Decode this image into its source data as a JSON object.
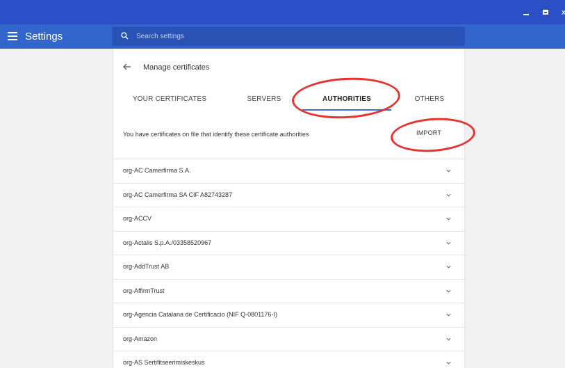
{
  "app": {
    "title": "Settings"
  },
  "window_controls": {
    "minimize_icon": "minimize-icon",
    "maximize_icon": "maximize-icon",
    "close_icon": "close-icon",
    "close_glyph": "x"
  },
  "search": {
    "placeholder": "Search settings",
    "value": ""
  },
  "page": {
    "title": "Manage certificates",
    "description": "You have certificates on file that identify these certificate authorities",
    "import_label": "IMPORT"
  },
  "tabs": [
    {
      "label": "YOUR CERTIFICATES",
      "active": false
    },
    {
      "label": "SERVERS",
      "active": false
    },
    {
      "label": "AUTHORITIES",
      "active": true
    },
    {
      "label": "OTHERS",
      "active": false
    }
  ],
  "authorities": [
    "org-AC Camerfirma S.A.",
    "org-AC Camerfirma SA CIF A82743287",
    "org-ACCV",
    "org-Actalis S.p.A./03358520967",
    "org-AddTrust AB",
    "org-AffirmTrust",
    "org-Agencia Catalana de Certificacio (NIF Q-0801176-I)",
    "org-Amazon",
    "org-AS Sertifitseerimiskeskus"
  ],
  "colors": {
    "titlebar": "#2b4fc4",
    "appbar": "#3366cc",
    "search_bg": "#2852b5",
    "accent": "#3b6fd6",
    "annotation": "#e8332f"
  }
}
